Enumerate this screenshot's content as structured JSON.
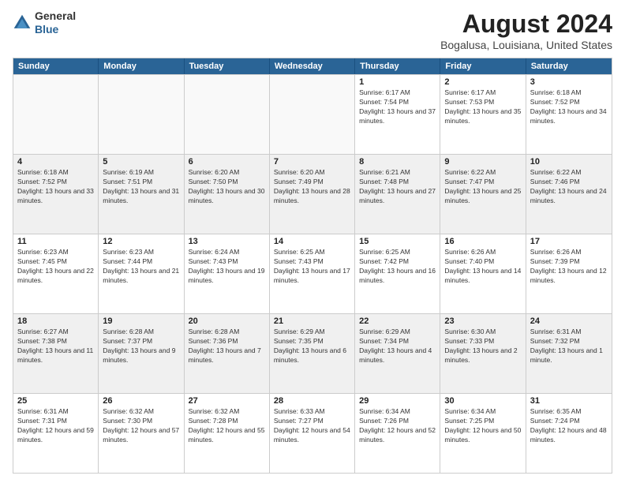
{
  "header": {
    "logo": {
      "general": "General",
      "blue": "Blue"
    },
    "title": "August 2024",
    "location": "Bogalusa, Louisiana, United States"
  },
  "calendar": {
    "days_of_week": [
      "Sunday",
      "Monday",
      "Tuesday",
      "Wednesday",
      "Thursday",
      "Friday",
      "Saturday"
    ],
    "weeks": [
      [
        {
          "day": "",
          "empty": true
        },
        {
          "day": "",
          "empty": true
        },
        {
          "day": "",
          "empty": true
        },
        {
          "day": "",
          "empty": true
        },
        {
          "day": "1",
          "sunrise": "Sunrise: 6:17 AM",
          "sunset": "Sunset: 7:54 PM",
          "daylight": "Daylight: 13 hours and 37 minutes."
        },
        {
          "day": "2",
          "sunrise": "Sunrise: 6:17 AM",
          "sunset": "Sunset: 7:53 PM",
          "daylight": "Daylight: 13 hours and 35 minutes."
        },
        {
          "day": "3",
          "sunrise": "Sunrise: 6:18 AM",
          "sunset": "Sunset: 7:52 PM",
          "daylight": "Daylight: 13 hours and 34 minutes."
        }
      ],
      [
        {
          "day": "4",
          "sunrise": "Sunrise: 6:18 AM",
          "sunset": "Sunset: 7:52 PM",
          "daylight": "Daylight: 13 hours and 33 minutes."
        },
        {
          "day": "5",
          "sunrise": "Sunrise: 6:19 AM",
          "sunset": "Sunset: 7:51 PM",
          "daylight": "Daylight: 13 hours and 31 minutes."
        },
        {
          "day": "6",
          "sunrise": "Sunrise: 6:20 AM",
          "sunset": "Sunset: 7:50 PM",
          "daylight": "Daylight: 13 hours and 30 minutes."
        },
        {
          "day": "7",
          "sunrise": "Sunrise: 6:20 AM",
          "sunset": "Sunset: 7:49 PM",
          "daylight": "Daylight: 13 hours and 28 minutes."
        },
        {
          "day": "8",
          "sunrise": "Sunrise: 6:21 AM",
          "sunset": "Sunset: 7:48 PM",
          "daylight": "Daylight: 13 hours and 27 minutes."
        },
        {
          "day": "9",
          "sunrise": "Sunrise: 6:22 AM",
          "sunset": "Sunset: 7:47 PM",
          "daylight": "Daylight: 13 hours and 25 minutes."
        },
        {
          "day": "10",
          "sunrise": "Sunrise: 6:22 AM",
          "sunset": "Sunset: 7:46 PM",
          "daylight": "Daylight: 13 hours and 24 minutes."
        }
      ],
      [
        {
          "day": "11",
          "sunrise": "Sunrise: 6:23 AM",
          "sunset": "Sunset: 7:45 PM",
          "daylight": "Daylight: 13 hours and 22 minutes."
        },
        {
          "day": "12",
          "sunrise": "Sunrise: 6:23 AM",
          "sunset": "Sunset: 7:44 PM",
          "daylight": "Daylight: 13 hours and 21 minutes."
        },
        {
          "day": "13",
          "sunrise": "Sunrise: 6:24 AM",
          "sunset": "Sunset: 7:43 PM",
          "daylight": "Daylight: 13 hours and 19 minutes."
        },
        {
          "day": "14",
          "sunrise": "Sunrise: 6:25 AM",
          "sunset": "Sunset: 7:43 PM",
          "daylight": "Daylight: 13 hours and 17 minutes."
        },
        {
          "day": "15",
          "sunrise": "Sunrise: 6:25 AM",
          "sunset": "Sunset: 7:42 PM",
          "daylight": "Daylight: 13 hours and 16 minutes."
        },
        {
          "day": "16",
          "sunrise": "Sunrise: 6:26 AM",
          "sunset": "Sunset: 7:40 PM",
          "daylight": "Daylight: 13 hours and 14 minutes."
        },
        {
          "day": "17",
          "sunrise": "Sunrise: 6:26 AM",
          "sunset": "Sunset: 7:39 PM",
          "daylight": "Daylight: 13 hours and 12 minutes."
        }
      ],
      [
        {
          "day": "18",
          "sunrise": "Sunrise: 6:27 AM",
          "sunset": "Sunset: 7:38 PM",
          "daylight": "Daylight: 13 hours and 11 minutes."
        },
        {
          "day": "19",
          "sunrise": "Sunrise: 6:28 AM",
          "sunset": "Sunset: 7:37 PM",
          "daylight": "Daylight: 13 hours and 9 minutes."
        },
        {
          "day": "20",
          "sunrise": "Sunrise: 6:28 AM",
          "sunset": "Sunset: 7:36 PM",
          "daylight": "Daylight: 13 hours and 7 minutes."
        },
        {
          "day": "21",
          "sunrise": "Sunrise: 6:29 AM",
          "sunset": "Sunset: 7:35 PM",
          "daylight": "Daylight: 13 hours and 6 minutes."
        },
        {
          "day": "22",
          "sunrise": "Sunrise: 6:29 AM",
          "sunset": "Sunset: 7:34 PM",
          "daylight": "Daylight: 13 hours and 4 minutes."
        },
        {
          "day": "23",
          "sunrise": "Sunrise: 6:30 AM",
          "sunset": "Sunset: 7:33 PM",
          "daylight": "Daylight: 13 hours and 2 minutes."
        },
        {
          "day": "24",
          "sunrise": "Sunrise: 6:31 AM",
          "sunset": "Sunset: 7:32 PM",
          "daylight": "Daylight: 13 hours and 1 minute."
        }
      ],
      [
        {
          "day": "25",
          "sunrise": "Sunrise: 6:31 AM",
          "sunset": "Sunset: 7:31 PM",
          "daylight": "Daylight: 12 hours and 59 minutes."
        },
        {
          "day": "26",
          "sunrise": "Sunrise: 6:32 AM",
          "sunset": "Sunset: 7:30 PM",
          "daylight": "Daylight: 12 hours and 57 minutes."
        },
        {
          "day": "27",
          "sunrise": "Sunrise: 6:32 AM",
          "sunset": "Sunset: 7:28 PM",
          "daylight": "Daylight: 12 hours and 55 minutes."
        },
        {
          "day": "28",
          "sunrise": "Sunrise: 6:33 AM",
          "sunset": "Sunset: 7:27 PM",
          "daylight": "Daylight: 12 hours and 54 minutes."
        },
        {
          "day": "29",
          "sunrise": "Sunrise: 6:34 AM",
          "sunset": "Sunset: 7:26 PM",
          "daylight": "Daylight: 12 hours and 52 minutes."
        },
        {
          "day": "30",
          "sunrise": "Sunrise: 6:34 AM",
          "sunset": "Sunset: 7:25 PM",
          "daylight": "Daylight: 12 hours and 50 minutes."
        },
        {
          "day": "31",
          "sunrise": "Sunrise: 6:35 AM",
          "sunset": "Sunset: 7:24 PM",
          "daylight": "Daylight: 12 hours and 48 minutes."
        }
      ]
    ]
  }
}
